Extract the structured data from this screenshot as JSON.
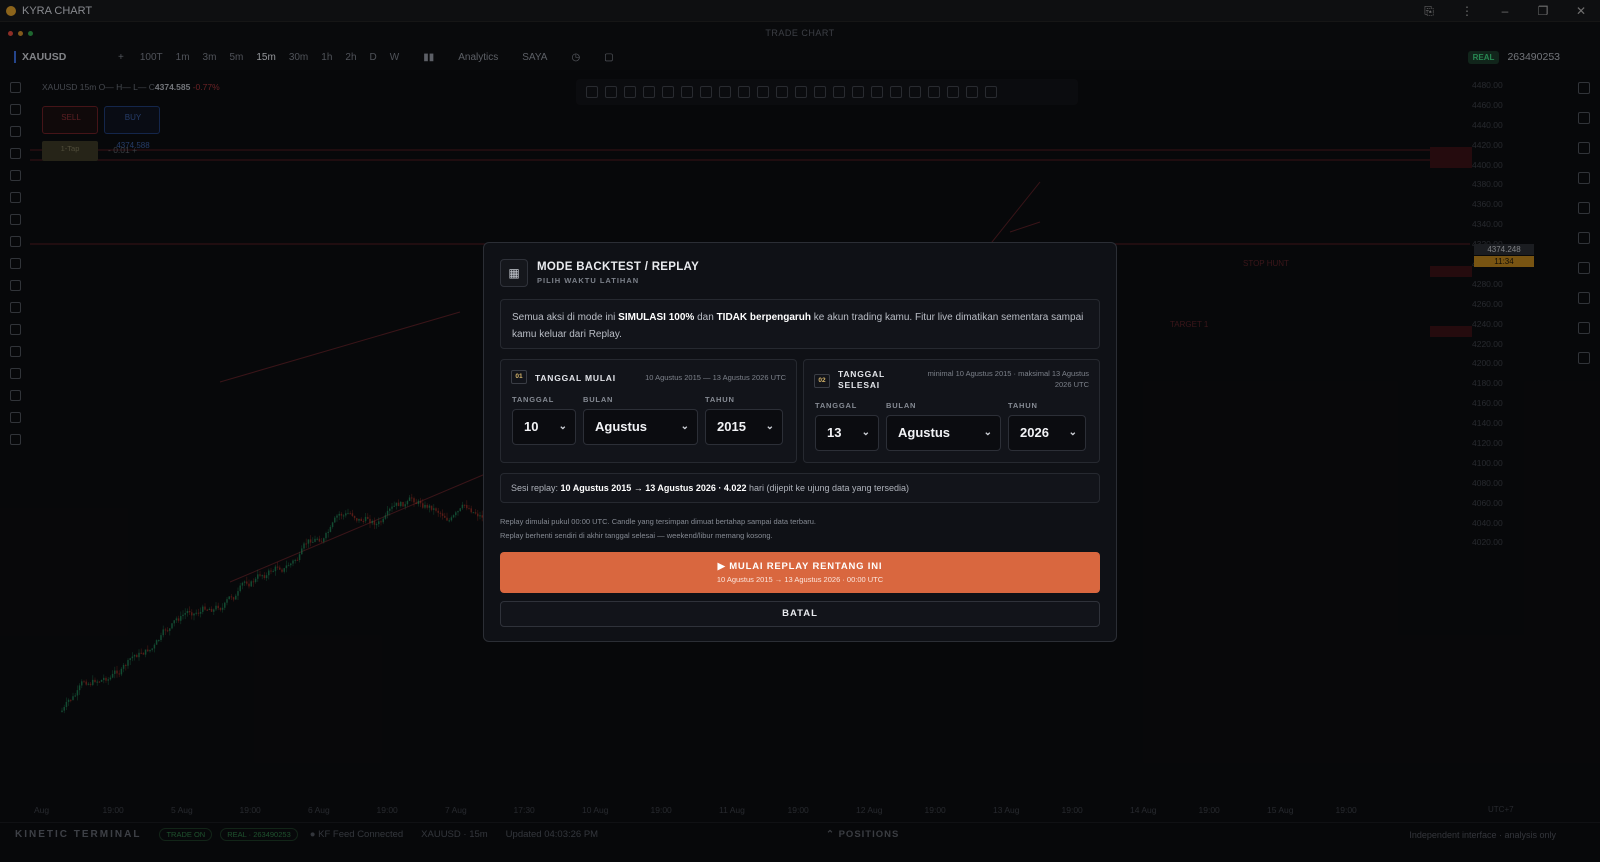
{
  "window": {
    "app_title": "KYRA CHART",
    "center_title": "TRADE CHART",
    "controls": [
      "⎘",
      "⋮",
      "–",
      "❐",
      "✕"
    ]
  },
  "toolbar": {
    "symbol": "XAUUSD",
    "add": "+",
    "timeframes": [
      "100T",
      "1m",
      "3m",
      "5m",
      "15m",
      "30m",
      "1h",
      "2h",
      "D",
      "W"
    ],
    "active_timeframe": "15m",
    "analytics": "Analytics",
    "saya": "SAYA",
    "account_badge": "REAL",
    "account_number": "263490253"
  },
  "chart": {
    "ohlc_line": "XAUUSD 15m O— H— L— C",
    "close_value": "4374.585",
    "change": "-0.77%",
    "sell_label": "SELL",
    "sell_price": "4374.248",
    "buy_label": "BUY",
    "buy_price": "4374.588",
    "lot_label": "1-Tap",
    "lot_value": "- 0.01 +",
    "price_labels": [
      "4480.00",
      "4460.00",
      "4440.00",
      "4420.00",
      "4400.00",
      "4380.00",
      "4360.00",
      "4340.00",
      "4320.00",
      "4300.00",
      "4280.00",
      "4260.00",
      "4240.00",
      "4220.00",
      "4200.00",
      "4180.00",
      "4160.00",
      "4140.00",
      "4120.00",
      "4100.00",
      "4080.00",
      "4060.00",
      "4040.00",
      "4020.00"
    ],
    "current_price": "4374.248",
    "countdown": "11:34",
    "stop_hunt": "STOP HUNT",
    "target": "TARGET 1",
    "time_labels": [
      "Aug",
      "19:00",
      "5 Aug",
      "19:00",
      "6 Aug",
      "19:00",
      "7 Aug",
      "17:30",
      "10 Aug",
      "19:00",
      "11 Aug",
      "19:00",
      "12 Aug",
      "19:00",
      "13 Aug",
      "19:00",
      "14 Aug",
      "19:00",
      "15 Aug",
      "19:00"
    ],
    "timezone": "UTC+7"
  },
  "modal": {
    "title": "MODE BACKTEST / REPLAY",
    "subtitle": "PILIH WAKTU LATIHAN",
    "notice_pre": "Semua aksi di mode ini ",
    "notice_b1": "SIMULASI 100%",
    "notice_mid": " dan ",
    "notice_b2": "TIDAK berpengaruh",
    "notice_post": " ke akun trading kamu. Fitur live dimatikan sementara sampai kamu keluar dari Replay.",
    "start": {
      "num": "01",
      "title": "TANGGAL MULAI",
      "range": "10 Agustus 2015 — 13 Agustus 2026 UTC",
      "day_label": "TANGGAL",
      "month_label": "BULAN",
      "year_label": "TAHUN",
      "day": "10",
      "month": "Agustus",
      "year": "2015"
    },
    "end": {
      "num": "02",
      "title_l1": "TANGGAL",
      "title_l2": "SELESAI",
      "range_l1": "minimal 10 Agustus 2015 · maksimal 13 Agustus",
      "range_l2": "2026 UTC",
      "day_label": "TANGGAL",
      "month_label": "BULAN",
      "year_label": "TAHUN",
      "day": "13",
      "month": "Agustus",
      "year": "2026"
    },
    "session_pre": "Sesi replay: ",
    "session_bold": "10 Agustus 2015 → 13 Agustus 2026 · 4.022",
    "session_post": " hari (dijepit ke ujung data yang tersedia)",
    "note1": "Replay dimulai pukul 00:00 UTC. Candle yang tersimpan dimuat bertahap sampai data terbaru.",
    "note2": "Replay berhenti sendiri di akhir tanggal selesai — weekend/libur memang kosong.",
    "start_button_l1": "▶ MULAI REPLAY RENTANG INI",
    "start_button_l2": "10 Agustus 2015 → 13 Agustus 2026 · 00:00 UTC",
    "cancel_button": "BATAL"
  },
  "status": {
    "brand": "KINETIC TERMINAL",
    "trade_pill": "TRADE ON",
    "real_pill": "REAL · 263490253",
    "feed": "● KF Feed Connected",
    "symbol_tf": "XAUUSD · 15m",
    "updated": "Updated 04:03:26 PM",
    "positions": "⌃ POSITIONS",
    "right_text": "Independent interface · analysis only"
  },
  "colors": {
    "accent": "#d9673f",
    "up": "#26a269",
    "down": "#c0392b",
    "channel": "#7a2a30"
  }
}
